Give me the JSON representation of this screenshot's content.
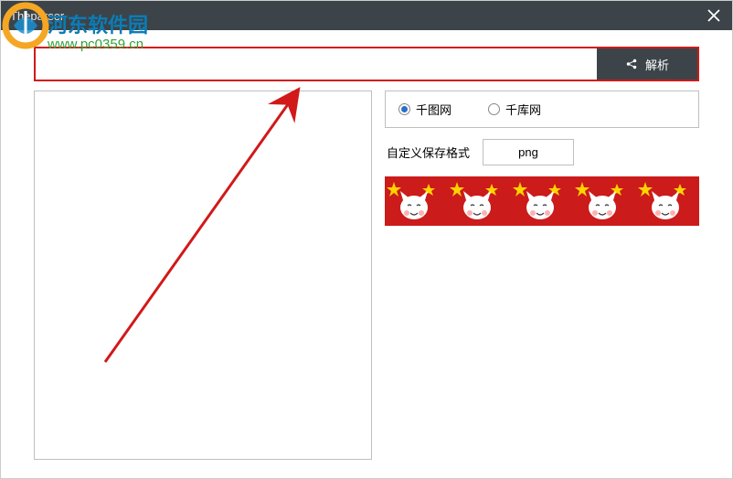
{
  "window": {
    "title": "Theparser"
  },
  "watermark": {
    "site_name": "河东软件园",
    "site_url": "www.pc0359.cn"
  },
  "input": {
    "value": "",
    "placeholder": ""
  },
  "parse_button": {
    "label": "解析"
  },
  "sites": {
    "option1": "千图网",
    "option2": "千库网",
    "selected": "option1"
  },
  "format": {
    "label": "自定义保存格式",
    "value": "png"
  }
}
